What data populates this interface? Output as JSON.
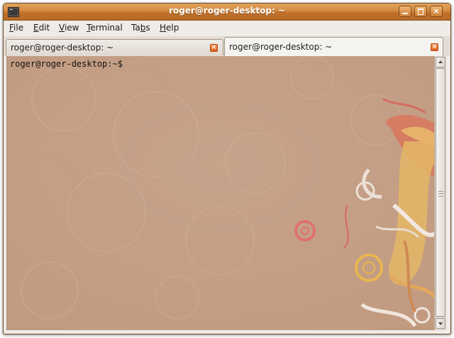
{
  "window": {
    "title": "roger@roger-desktop: ~",
    "icons": {
      "app": "terminal-icon",
      "minimize": "minimize-icon",
      "maximize": "maximize-icon",
      "close": "close-icon"
    },
    "close_glyph": "×"
  },
  "menubar": {
    "items": [
      {
        "mnemonic": "F",
        "rest": "ile"
      },
      {
        "mnemonic": "E",
        "rest": "dit"
      },
      {
        "mnemonic": "V",
        "rest": "iew"
      },
      {
        "mnemonic": "T",
        "rest": "erminal"
      },
      {
        "pre": "Ta",
        "mnemonic": "b",
        "rest": "s"
      },
      {
        "mnemonic": "H",
        "rest": "elp"
      }
    ]
  },
  "tabs": [
    {
      "label": "roger@roger-desktop: ~",
      "active": false,
      "close_glyph": "×"
    },
    {
      "label": "roger@roger-desktop: ~",
      "active": true,
      "close_glyph": "×"
    }
  ],
  "terminal": {
    "prompt": "roger@roger-desktop:~$ ",
    "background_color": "#c49f86",
    "text_color": "#111111"
  },
  "colors": {
    "titlebar": "#d48a3e",
    "window_bg": "#efebe7",
    "tab_close": "#e2601c"
  }
}
